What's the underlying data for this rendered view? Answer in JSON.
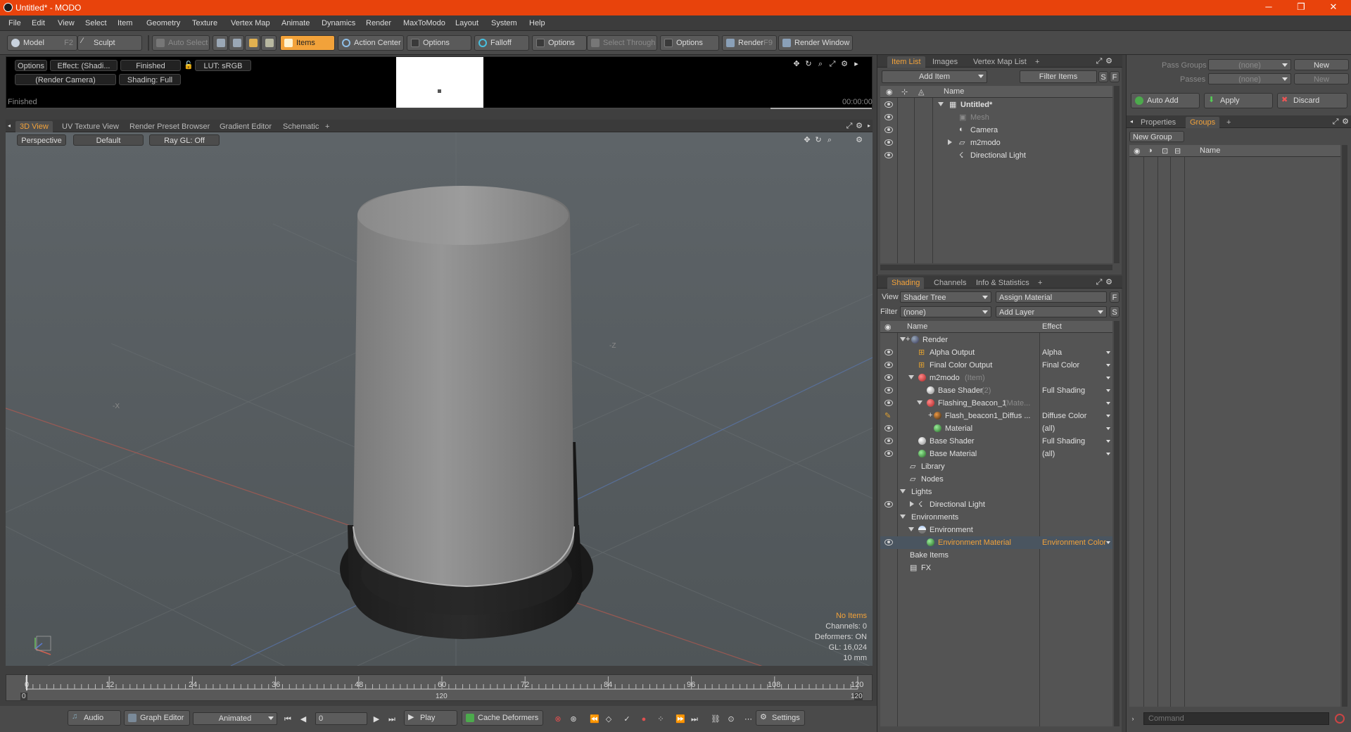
{
  "window": {
    "title": "Untitled* - MODO",
    "min": "─",
    "max": "❐",
    "close": "✕"
  },
  "menu": [
    "File",
    "Edit",
    "View",
    "Select",
    "Item",
    "Geometry",
    "Texture",
    "Vertex Map",
    "Animate",
    "Dynamics",
    "Render",
    "MaxToModo",
    "Layout",
    "System",
    "Help"
  ],
  "toolbar": {
    "model": "Model",
    "model_key": "F2",
    "sculpt": "Sculpt",
    "auto_select": "Auto Select",
    "items": "Items",
    "action_center": "Action Center",
    "options1": "Options",
    "falloff": "Falloff",
    "options2": "Options",
    "select_through": "Select Through",
    "options3": "Options",
    "render": "Render",
    "render_key": "F9",
    "render_window": "Render Window"
  },
  "preview": {
    "options": "Options",
    "effect": "Effect: (Shadi...",
    "finished_btn": "Finished",
    "lut": "LUT: sRGB",
    "camera": "(Render Camera)",
    "shading": "Shading: Full",
    "status": "Finished",
    "time": "00:00:00"
  },
  "viewport_tabs": [
    "3D View",
    "UV Texture View",
    "Render Preset Browser",
    "Gradient Editor",
    "Schematic",
    "+"
  ],
  "viewport": {
    "perspective": "Perspective",
    "default": "Default",
    "raygl": "Ray GL: Off",
    "axis_label": "-Z",
    "axis_label2": "-X",
    "info": {
      "no_items": "No Items",
      "channels": "Channels: 0",
      "deformers": "Deformers: ON",
      "gl": "GL: 16,024",
      "scale": "10 mm"
    }
  },
  "timeline": {
    "ticks": [
      "0",
      "12",
      "24",
      "36",
      "48",
      "60",
      "72",
      "84",
      "96",
      "108",
      "120"
    ],
    "sub_left": "0",
    "sub_mid": "120",
    "sub_right": "120"
  },
  "bottombar": {
    "audio": "Audio",
    "graph_editor": "Graph Editor",
    "animated": "Animated",
    "frame": "0",
    "play": "Play",
    "cache_deformers": "Cache Deformers",
    "settings": "Settings"
  },
  "itemlist": {
    "tabs": [
      "Item List",
      "Images",
      "Vertex Map List",
      "+"
    ],
    "add_item": "Add Item",
    "filter_items": "Filter Items",
    "s": "S",
    "f": "F",
    "name_col": "Name",
    "items": [
      {
        "label": "Untitled*"
      },
      {
        "label": "Mesh"
      },
      {
        "label": "Camera"
      },
      {
        "label": "m2modo"
      },
      {
        "label": "Directional Light"
      }
    ]
  },
  "shading": {
    "tabs": [
      "Shading",
      "Channels",
      "Info & Statistics",
      "+"
    ],
    "view_label": "View",
    "view_value": "Shader Tree",
    "assign_material": "Assign Material",
    "f": "F",
    "filter_label": "Filter",
    "filter_value": "(none)",
    "add_layer": "Add Layer",
    "s": "S",
    "name_col": "Name",
    "effect_col": "Effect",
    "rows": [
      {
        "name": "Render",
        "effect": "",
        "suffix": ""
      },
      {
        "name": "Alpha Output",
        "effect": "Alpha",
        "suffix": ""
      },
      {
        "name": "Final Color Output",
        "effect": "Final Color",
        "suffix": ""
      },
      {
        "name": "m2modo",
        "effect": "",
        "suffix": "(Item)"
      },
      {
        "name": "Base Shader",
        "effect": "Full Shading",
        "suffix": "(2)"
      },
      {
        "name": "Flashing_Beacon_1",
        "effect": "",
        "suffix": "(Mate..."
      },
      {
        "name": "Flash_beacon1_Diffus ...",
        "effect": "Diffuse Color",
        "suffix": ""
      },
      {
        "name": "Material",
        "effect": "(all)",
        "suffix": ""
      },
      {
        "name": "Base Shader",
        "effect": "Full Shading",
        "suffix": ""
      },
      {
        "name": "Base Material",
        "effect": "(all)",
        "suffix": ""
      },
      {
        "name": "Library",
        "effect": "",
        "suffix": ""
      },
      {
        "name": "Nodes",
        "effect": "",
        "suffix": ""
      },
      {
        "name": "Lights",
        "effect": "",
        "suffix": ""
      },
      {
        "name": "Directional Light",
        "effect": "",
        "suffix": ""
      },
      {
        "name": "Environments",
        "effect": "",
        "suffix": ""
      },
      {
        "name": "Environment",
        "effect": "",
        "suffix": ""
      },
      {
        "name": "Environment Material",
        "effect": "Environment Color",
        "suffix": ""
      },
      {
        "name": "Bake Items",
        "effect": "",
        "suffix": ""
      },
      {
        "name": "FX",
        "effect": "",
        "suffix": ""
      }
    ]
  },
  "groups": {
    "pass_groups_label": "Pass Groups",
    "pass_groups_value": "(none)",
    "new1": "New",
    "passes_label": "Passes",
    "passes_value": "(none)",
    "new2": "New",
    "auto_add": "Auto Add",
    "apply": "Apply",
    "discard": "Discard",
    "tabs": [
      "Properties",
      "Groups",
      "+"
    ],
    "new_group": "New Group",
    "name_col": "Name",
    "command_placeholder": "Command"
  }
}
